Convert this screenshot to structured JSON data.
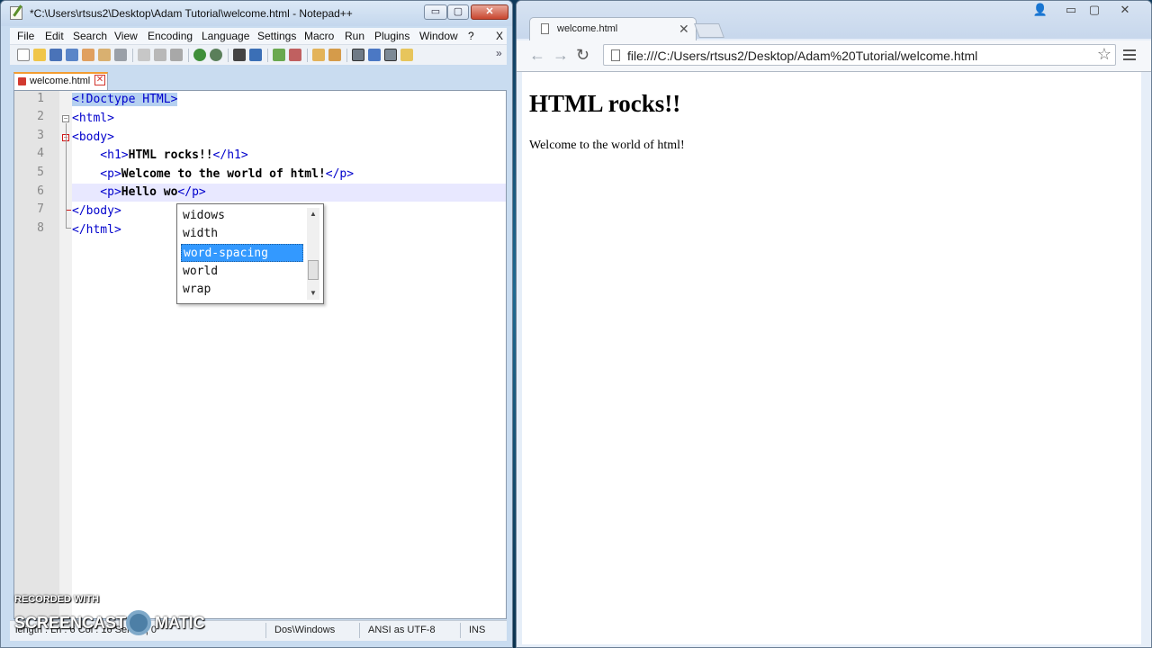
{
  "notepad": {
    "title": "*C:\\Users\\rtsus2\\Desktop\\Adam Tutorial\\welcome.html - Notepad++",
    "window_buttons": {
      "minimize": "▭",
      "maximize": "▢",
      "close": "✕"
    },
    "menu": [
      "File",
      "Edit",
      "Search",
      "View",
      "Encoding",
      "Language",
      "Settings",
      "Macro",
      "Run",
      "Plugins",
      "Window",
      "?",
      "X"
    ],
    "tab": {
      "label": "welcome.html",
      "close": "✕"
    },
    "lines": [
      {
        "n": "1",
        "text": "<!Doctype HTML>"
      },
      {
        "n": "2",
        "text": "<html>"
      },
      {
        "n": "3",
        "text": "<body>"
      },
      {
        "n": "4",
        "pre": "    <h1>",
        "bold": "HTML rocks!!",
        "post": "</h1>"
      },
      {
        "n": "5",
        "pre": "    <p>",
        "bold": "Welcome to the world of html!",
        "post": "</p>"
      },
      {
        "n": "6",
        "pre": "    <p>",
        "bold": "Hello wo",
        "post": "</p>"
      },
      {
        "n": "7",
        "text": "</body>"
      },
      {
        "n": "8",
        "text": "</html>"
      }
    ],
    "autocomplete": {
      "items": [
        "widows",
        "width",
        "word-spacing",
        "world",
        "wrap"
      ],
      "selected": "word-spacing"
    },
    "status": {
      "position": "length : Ln : 6   Col : 16   Sel : 0 | 0",
      "eol": "Dos\\Windows",
      "encoding": "ANSI as UTF-8",
      "mode": "INS"
    }
  },
  "watermark": {
    "line1": "RECORDED WITH",
    "line2a": "SCREENCAST",
    "line2b": "MATIC"
  },
  "browser": {
    "tab_title": "welcome.html",
    "tab_close": "✕",
    "window_buttons": {
      "user": "👤",
      "minimize": "▭",
      "maximize": "▢",
      "close": "✕"
    },
    "nav": {
      "back": "←",
      "forward": "→",
      "reload": "↻"
    },
    "url": "file:///C:/Users/rtsus2/Desktop/Adam%20Tutorial/welcome.html",
    "star": "☆",
    "page": {
      "heading": "HTML rocks!!",
      "paragraph": "Welcome to the world of html!"
    }
  },
  "colors": {
    "tag": "#0000cc",
    "selection": "#3399ff",
    "current_line": "#e8e8ff",
    "fold_marker": "#d01616"
  }
}
